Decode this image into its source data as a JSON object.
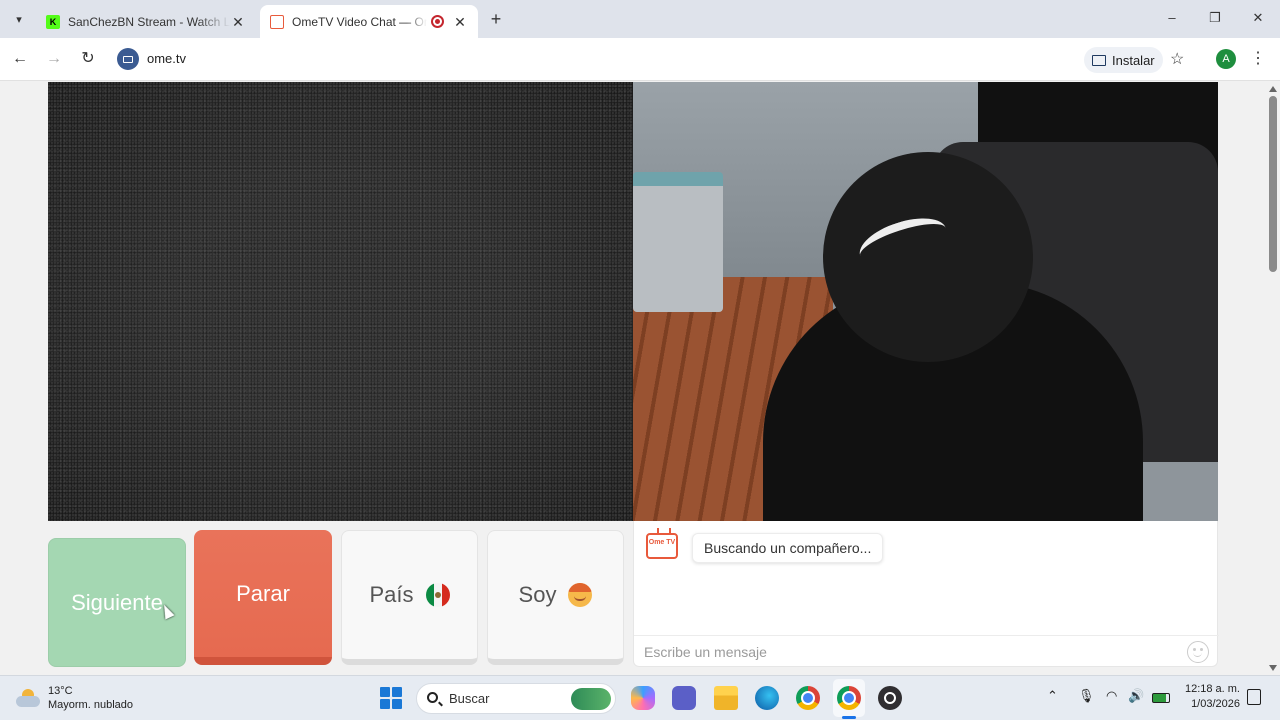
{
  "browser": {
    "tabs": [
      {
        "title": "SanChezBN Stream - Watch Live",
        "favicon": "kick-icon",
        "active": false
      },
      {
        "title": "OmeTV Video Chat — Ome",
        "favicon": "ometv-icon",
        "active": true
      }
    ],
    "url": "ome.tv",
    "install_label": "Instalar",
    "profile_initial": "A"
  },
  "page": {
    "buttons": {
      "next_label": "Siguiente",
      "stop_label": "Parar",
      "country_label": "País",
      "country_flag": "mexico-flag-icon",
      "gender_label": "Soy",
      "gender_icon": "boy-face-icon"
    },
    "chat": {
      "logo_text": "Ome TV",
      "status_message": "Buscando un compañero...",
      "input_placeholder": "Escribe un mensaje"
    },
    "colors": {
      "next": "#a4d7b2",
      "stop": "#e66a50",
      "brand": "#e8593b"
    }
  },
  "taskbar": {
    "weather_temp": "13°C",
    "weather_desc": "Mayorm. nublado",
    "search_placeholder": "Buscar",
    "time": "12:18 a. m.",
    "date": "1/03/2026"
  }
}
